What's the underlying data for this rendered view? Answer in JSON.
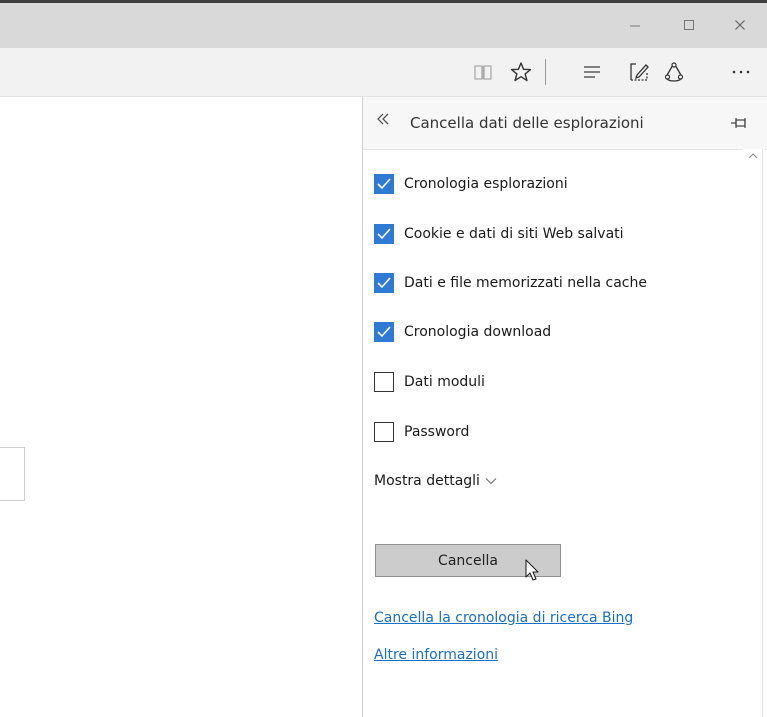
{
  "window": {
    "minimize_icon": "minimize-icon",
    "maximize_icon": "maximize-icon",
    "close_icon": "close-icon"
  },
  "toolbar": {
    "icons": [
      "reading-view-icon",
      "favorites-star-icon",
      "hub-icon",
      "web-note-icon",
      "share-icon",
      "more-icon"
    ]
  },
  "panel": {
    "title": "Cancella dati delle esplorazioni",
    "back_icon": "double-chevron-left-icon",
    "pin_icon": "pin-icon",
    "options": [
      {
        "label": "Cronologia esplorazioni",
        "checked": true
      },
      {
        "label": "Cookie e dati di siti Web salvati",
        "checked": true
      },
      {
        "label": "Dati e file memorizzati nella cache",
        "checked": true
      },
      {
        "label": "Cronologia download",
        "checked": true
      },
      {
        "label": "Dati moduli",
        "checked": false
      },
      {
        "label": "Password",
        "checked": false
      }
    ],
    "show_details": "Mostra dettagli",
    "clear_button": "Cancella",
    "link_bing": "Cancella la cronologia di ricerca Bing",
    "link_more": "Altre informazioni"
  },
  "colors": {
    "accent": "#2f7bd3",
    "link": "#1b6fc3",
    "titlebar": "#d9d9d9",
    "toolbar": "#f2f2f2"
  }
}
